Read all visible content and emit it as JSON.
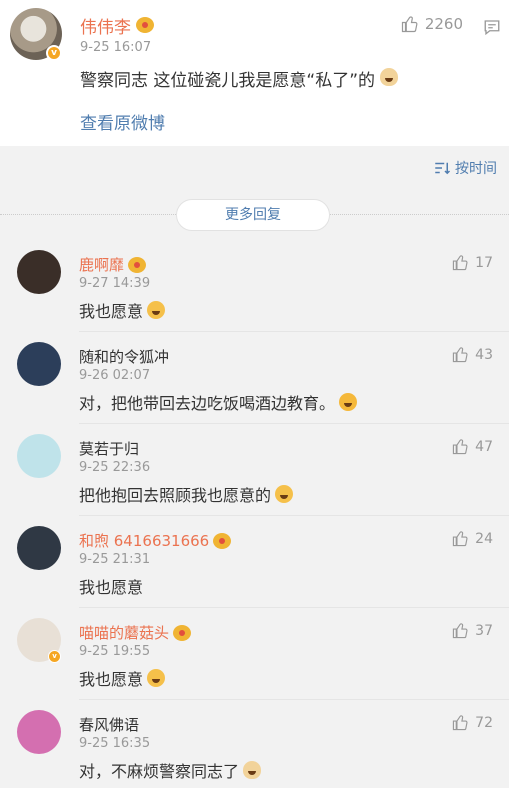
{
  "post": {
    "name": "伟伟李",
    "time": "9-25 16:07",
    "text": "警察同志 这位碰瓷儿我是愿意“私了”的",
    "view_original": "查看原微博",
    "likes": "2260",
    "icons": {
      "like": "thumb-up-icon",
      "comment": "comment-icon",
      "verified": "verified-badge-icon"
    }
  },
  "toolbar": {
    "sort_label": "按时间",
    "more_replies": "更多回复"
  },
  "comments": [
    {
      "name": "鹿啊靡",
      "vip": true,
      "time": "9-27 14:39",
      "text": "我也愿意",
      "likes": "17",
      "emoji": "shocked",
      "avatar_color": "#3a2e28",
      "verified": false
    },
    {
      "name": "随和的令狐冲",
      "vip": false,
      "time": "9-26 02:07",
      "text": "对，把他带回去边吃饭喝酒边教育。",
      "likes": "43",
      "emoji": "laugh",
      "avatar_color": "#2c3e5a",
      "verified": false
    },
    {
      "name": "莫若于归",
      "vip": false,
      "time": "9-25 22:36",
      "text": "把他抱回去照顾我也愿意的",
      "likes": "47",
      "emoji": "shocked",
      "avatar_color": "#bfe3ea",
      "verified": false
    },
    {
      "name": "和煦 6416631666",
      "vip": true,
      "time": "9-25 21:31",
      "text": "我也愿意",
      "likes": "24",
      "emoji": "",
      "avatar_color": "#2f3844",
      "verified": false
    },
    {
      "name": "喵喵的蘑菇头",
      "vip": true,
      "time": "9-25 19:55",
      "text": "我也愿意",
      "likes": "37",
      "emoji": "shocked",
      "avatar_color": "#e8e0d6",
      "verified": true
    },
    {
      "name": "春风佛语",
      "vip": false,
      "time": "9-25 16:35",
      "text": "对，不麻烦警察同志了",
      "likes": "72",
      "emoji": "cat",
      "avatar_color": "#d46fb0",
      "verified": false
    }
  ]
}
